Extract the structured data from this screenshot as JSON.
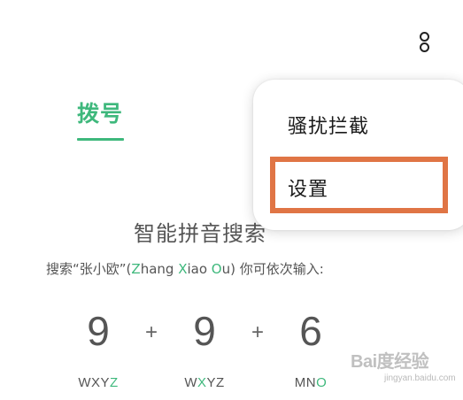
{
  "header": {
    "more_icon": "more-vertical-icon"
  },
  "tabs": {
    "dial_label": "拨号",
    "accent_color": "#3eb87c"
  },
  "popup_menu": {
    "items": [
      {
        "label": "骚扰拦截"
      },
      {
        "label": "设置"
      }
    ],
    "highlighted_item": "设置",
    "highlight_color": "#e07545"
  },
  "smart_search": {
    "title": "智能拼音搜索",
    "hint": {
      "before": "搜索“张小欧”(",
      "z": "Z",
      "hang": "hang ",
      "x": "X",
      "iao": "iao ",
      "o": "O",
      "after": "u) 你可依次输入:"
    },
    "keys": [
      {
        "digit": "9",
        "letters_plain": "WXY",
        "letters_hl": "Z",
        "letters_after": ""
      },
      {
        "digit": "9",
        "letters_plain": "W",
        "letters_hl": "X",
        "letters_after": "YZ"
      },
      {
        "digit": "6",
        "letters_plain": "MN",
        "letters_hl": "O",
        "letters_after": ""
      }
    ],
    "plus": "+"
  },
  "watermark": {
    "logo": "Bai度经验",
    "sub": "jingyan.baidu.com"
  }
}
